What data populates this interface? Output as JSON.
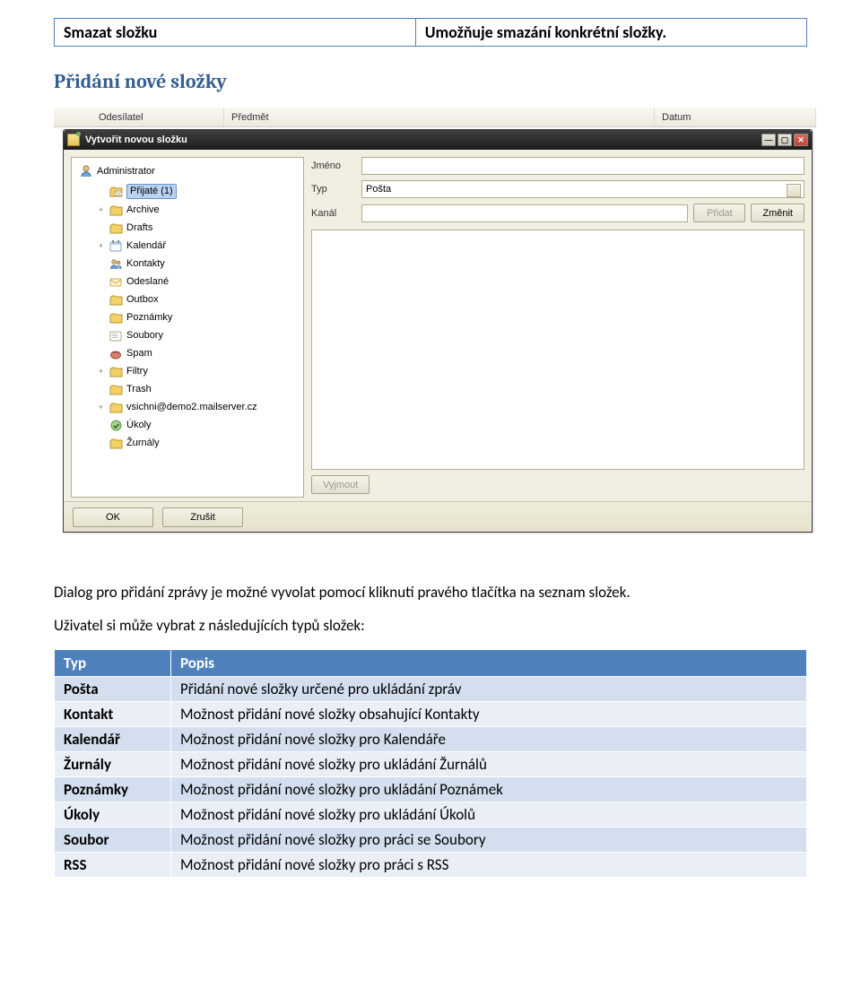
{
  "header_row": {
    "col1": "Smazat složku",
    "col2": "Umožňuje smazání konkrétní složky."
  },
  "heading": "Přidání nové složky",
  "grid": {
    "sender": "Odesílatel",
    "subject": "Předmět",
    "date": "Datum"
  },
  "dialog": {
    "title": "Vytvořit novou složku",
    "tree_root": "Administrator",
    "tree": [
      {
        "label": "Přijaté (1)",
        "icon": "mail-folder",
        "expander": "",
        "selected": true
      },
      {
        "label": "Archive",
        "icon": "folder",
        "expander": "+"
      },
      {
        "label": "Drafts",
        "icon": "folder",
        "expander": ""
      },
      {
        "label": "Kalendář",
        "icon": "calendar",
        "expander": "+"
      },
      {
        "label": "Kontakty",
        "icon": "contacts",
        "expander": ""
      },
      {
        "label": "Odeslané",
        "icon": "sent",
        "expander": ""
      },
      {
        "label": "Outbox",
        "icon": "folder",
        "expander": ""
      },
      {
        "label": "Poznámky",
        "icon": "folder",
        "expander": ""
      },
      {
        "label": "Soubory",
        "icon": "files",
        "expander": ""
      },
      {
        "label": "Spam",
        "icon": "spam",
        "expander": ""
      },
      {
        "label": "Filtry",
        "icon": "folder",
        "expander": "+"
      },
      {
        "label": "Trash",
        "icon": "folder",
        "expander": ""
      },
      {
        "label": "vsichni@demo2.mailserver.cz",
        "icon": "folder",
        "expander": "+"
      },
      {
        "label": "Úkoly",
        "icon": "tasks",
        "expander": ""
      },
      {
        "label": "Žurnály",
        "icon": "folder",
        "expander": ""
      }
    ],
    "form": {
      "name_label": "Jméno",
      "name_value": "",
      "type_label": "Typ",
      "type_value": "Pošta",
      "channel_label": "Kanál",
      "channel_value": "",
      "add_btn": "Přidat",
      "change_btn": "Změnit",
      "remove_btn": "Vyjmout"
    },
    "ok": "OK",
    "cancel": "Zrušit"
  },
  "para1": "Dialog pro přidání zprávy je možné vyvolat pomocí kliknutí pravého tlačítka na seznam složek.",
  "para2": "Uživatel si může vybrat z následujících typů složek:",
  "table": {
    "h1": "Typ",
    "h2": "Popis",
    "rows": [
      {
        "t": "Pošta",
        "d": "Přidání nové složky určené pro ukládání zpráv"
      },
      {
        "t": "Kontakt",
        "d": "Možnost přidání nové složky obsahující Kontakty"
      },
      {
        "t": "Kalendář",
        "d": "Možnost přidání nové složky pro Kalendáře"
      },
      {
        "t": "Žurnály",
        "d": "Možnost přidání nové složky pro ukládání Žurnálů"
      },
      {
        "t": "Poznámky",
        "d": "Možnost přidání nové složky pro ukládání Poznámek"
      },
      {
        "t": "Úkoly",
        "d": "Možnost přidání nové složky pro ukládání Úkolů"
      },
      {
        "t": "Soubor",
        "d": "Možnost přidání nové složky pro práci se Soubory"
      },
      {
        "t": "RSS",
        "d": "Možnost přidání nové složky pro práci s RSS"
      }
    ]
  },
  "icons": {
    "folder": "#d9b63a",
    "calendar": "#7aa7d9",
    "contacts": "#7aa7d9",
    "spam": "#c76b5b",
    "tasks": "#6fae4b"
  }
}
